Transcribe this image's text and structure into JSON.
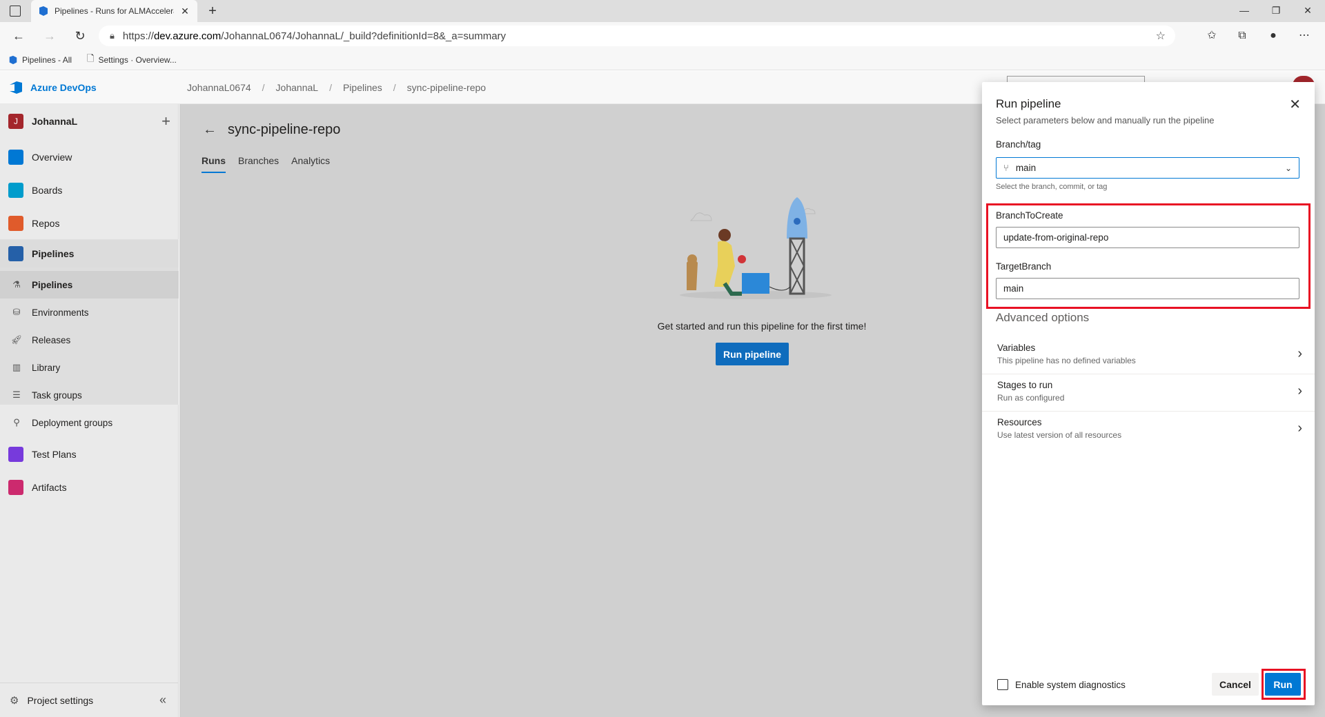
{
  "browser": {
    "tab_title": "Pipelines - Runs for ALMAccelerator",
    "url_prefix": "https://",
    "url_host": "dev.azure.com",
    "url_path": "/JohannaL0674/JohannaL/_build?definitionId=8&_a=summary",
    "favorites": [
      "Pipelines - All",
      "Settings · Overview..."
    ]
  },
  "ado": {
    "brand": "Azure DevOps",
    "breadcrumbs": [
      "JohannaL0674",
      "JohannaL",
      "Pipelines",
      "sync-pipeline-repo"
    ]
  },
  "sidebar": {
    "project_initial": "J",
    "project_name": "JohannaL",
    "items": [
      {
        "label": "Overview",
        "color": "#0078d4"
      },
      {
        "label": "Boards",
        "color": "#009ccc"
      },
      {
        "label": "Repos",
        "color": "#e05b2b"
      },
      {
        "label": "Pipelines",
        "color": "#2560a8"
      }
    ],
    "sub_items": [
      "Pipelines",
      "Environments",
      "Releases",
      "Library",
      "Task groups",
      "Deployment groups"
    ],
    "items2": [
      {
        "label": "Test Plans",
        "color": "#773adc"
      },
      {
        "label": "Artifacts",
        "color": "#cc2a6e"
      }
    ],
    "footer": "Project settings"
  },
  "main": {
    "title": "sync-pipeline-repo",
    "tabs": [
      "Runs",
      "Branches",
      "Analytics"
    ],
    "empty_message": "Get started and run this pipeline for the first time!",
    "run_button": "Run pipeline"
  },
  "panel": {
    "title": "Run pipeline",
    "subtitle": "Select parameters below and manually run the pipeline",
    "branch_label": "Branch/tag",
    "branch_value": "main",
    "branch_hint": "Select the branch, commit, or tag",
    "param1_label": "BranchToCreate",
    "param1_value": "update-from-original-repo",
    "param2_label": "TargetBranch",
    "param2_value": "main",
    "advanced": "Advanced options",
    "rows": [
      {
        "title": "Variables",
        "sub": "This pipeline has no defined variables"
      },
      {
        "title": "Stages to run",
        "sub": "Run as configured"
      },
      {
        "title": "Resources",
        "sub": "Use latest version of all resources"
      }
    ],
    "diagnostics": "Enable system diagnostics",
    "cancel": "Cancel",
    "run": "Run"
  }
}
